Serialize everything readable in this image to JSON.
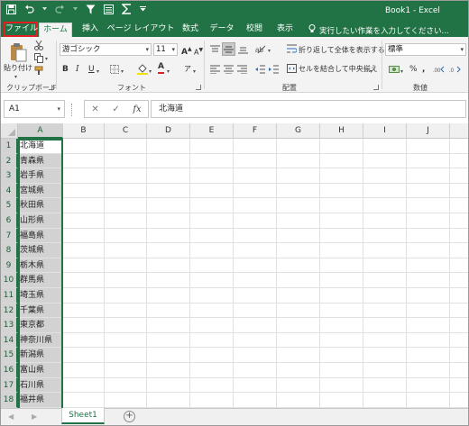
{
  "window": {
    "title": "Book1 - Excel"
  },
  "tabs": [
    {
      "id": "file",
      "label": "ファイル"
    },
    {
      "id": "home",
      "label": "ホーム"
    },
    {
      "id": "insert",
      "label": "挿入"
    },
    {
      "id": "page_layout",
      "label": "ページ レイアウト"
    },
    {
      "id": "formulas",
      "label": "数式"
    },
    {
      "id": "data",
      "label": "データ"
    },
    {
      "id": "review",
      "label": "校閲"
    },
    {
      "id": "view",
      "label": "表示"
    }
  ],
  "tell_me": {
    "placeholder": "実行したい作業を入力してください..."
  },
  "ribbon": {
    "clipboard": {
      "paste_label": "貼り付け",
      "group_label": "クリップボード"
    },
    "font": {
      "font_name": "游ゴシック",
      "font_size": "11",
      "bold": "B",
      "italic": "I",
      "underline": "U",
      "grow": "A",
      "shrink": "A",
      "font_color_letter": "A",
      "phonetic": "ア",
      "group_label": "フォント"
    },
    "alignment": {
      "wrap_text": "折り返して全体を表示する",
      "merge_center": "セルを結合して中央揃え",
      "group_label": "配置"
    },
    "number": {
      "format": "標準",
      "percent": "%",
      "comma": ",",
      "group_label": "数値"
    }
  },
  "formula_bar": {
    "name_box": "A1",
    "cancel": "✕",
    "enter": "✓",
    "fx": "fx",
    "content": "北海道"
  },
  "grid": {
    "columns": [
      "A",
      "B",
      "C",
      "D",
      "E",
      "F",
      "G",
      "H",
      "I",
      "J"
    ],
    "rows": [
      "1",
      "2",
      "3",
      "4",
      "5",
      "6",
      "7",
      "8",
      "9",
      "10",
      "11",
      "12",
      "13",
      "14",
      "15",
      "16",
      "17",
      "18"
    ],
    "column_a_values": [
      "北海道",
      "青森県",
      "岩手県",
      "宮城県",
      "秋田県",
      "山形県",
      "福島県",
      "茨城県",
      "栃木県",
      "群馬県",
      "埼玉県",
      "千葉県",
      "東京都",
      "神奈川県",
      "新潟県",
      "富山県",
      "石川県",
      "福井県"
    ]
  },
  "sheets": {
    "active": "Sheet1",
    "add_label": "+"
  },
  "colors": {
    "excel_green": "#217346",
    "file_tab_highlight": "#e02020",
    "selection_fill": "#d2d2d2"
  }
}
